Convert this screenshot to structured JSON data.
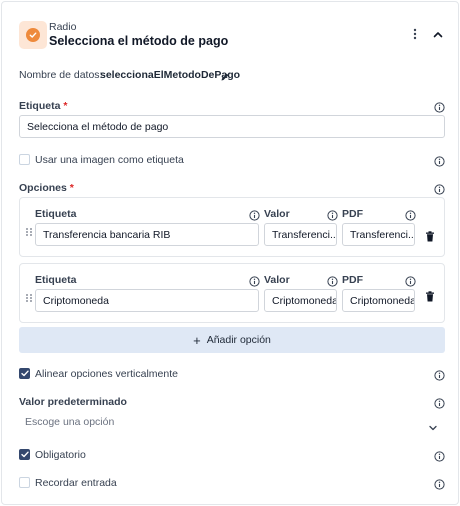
{
  "header": {
    "type_label": "Radio",
    "title": "Selecciona el método de pago"
  },
  "data_name": {
    "label": "Nombre de datos:",
    "value": "seleccionaElMetodoDePago"
  },
  "etiqueta": {
    "label": "Etiqueta",
    "required_mark": "*",
    "value": "Selecciona el método de pago"
  },
  "image_label": {
    "label": "Usar una imagen como etiqueta",
    "checked": false
  },
  "opciones": {
    "label": "Opciones",
    "required_mark": "*",
    "columns": {
      "etiqueta": "Etiqueta",
      "valor": "Valor",
      "pdf": "PDF"
    },
    "items": [
      {
        "etiqueta": "Transferencia bancaria RIB",
        "valor": "Transferenci...",
        "pdf": "Transferenci..."
      },
      {
        "etiqueta": "Criptomoneda",
        "valor": "Criptomoneda",
        "pdf": "Criptomoneda"
      }
    ],
    "add_label": "Añadir opción",
    "add_icon": "+"
  },
  "align_vertical": {
    "label": "Alinear opciones verticalmente",
    "checked": true
  },
  "default_value": {
    "label": "Valor predeterminado",
    "placeholder": "Escoge una opción"
  },
  "required": {
    "label": "Obligatorio",
    "checked": true
  },
  "remember": {
    "label": "Recordar entrada",
    "checked": false
  },
  "colors": {
    "accent_orange": "#ee8a3c",
    "badge_bg": "#fde6d6",
    "checkbox_checked": "#34486e",
    "add_button_bg": "#dfe8f5",
    "required_red": "#dc2626"
  }
}
